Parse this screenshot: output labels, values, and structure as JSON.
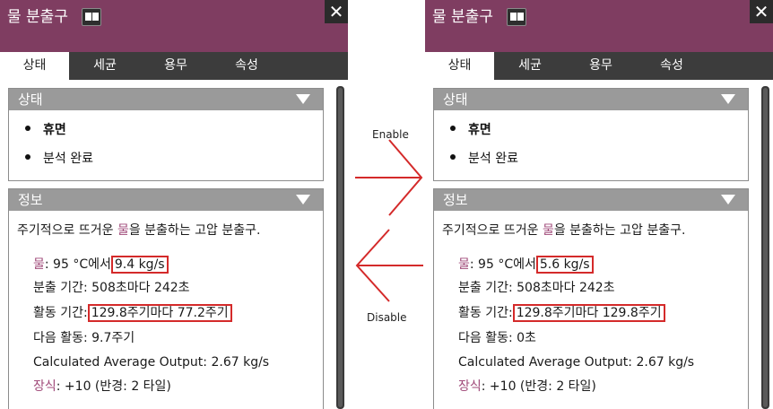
{
  "panels": {
    "before": {
      "title": "물 분출구",
      "close_label": "✕",
      "tabs": [
        "상태",
        "세균",
        "용무",
        "속성"
      ],
      "status_header": "상태",
      "status_items": [
        "휴면",
        "분석 완료"
      ],
      "info_header": "정보",
      "description_pre": "주기적으로 뜨거운 ",
      "description_word": "물",
      "description_post": "을 분출하는 고압 분출구.",
      "water_label": "물",
      "water_temp": ": 95 °C에서",
      "water_rate": "9.4 kg/s",
      "eruption_label": "분출 기간: 508초마다 242초",
      "active_label": "활동 기간:",
      "active_value": "129.8주기마다 77.2주기",
      "next_label": "다음 활동: 9.7주기",
      "avg_output": "Calculated Average Output: 2.67 kg/s",
      "decor_label": "장식",
      "decor_value": ": +10 (반경: 2 타일)"
    },
    "after": {
      "title": "물 분출구",
      "close_label": "✕",
      "tabs": [
        "상태",
        "세균",
        "용무",
        "속성"
      ],
      "status_header": "상태",
      "status_items": [
        "휴면",
        "분석 완료"
      ],
      "info_header": "정보",
      "description_pre": "주기적으로 뜨거운 ",
      "description_word": "물",
      "description_post": "을 분출하는 고압 분출구.",
      "water_label": "물",
      "water_temp": ": 95 °C에서",
      "water_rate": "5.6 kg/s",
      "eruption_label": "분출 기간: 508초마다 242초",
      "active_label": "활동 기간:",
      "active_value": "129.8주기마다 129.8주기",
      "next_label": "다음 활동: 0초",
      "avg_output": "Calculated Average Output: 2.67 kg/s",
      "decor_label": "장식",
      "decor_value": ": +10 (반경: 2 타일)"
    }
  },
  "arrows": {
    "enable_label": "Enable",
    "disable_label": "Disable",
    "color": "#d42a2a"
  },
  "colors": {
    "titlebar": "#7f3d61",
    "highlight_box": "#d42a2a",
    "pink_text": "#a04a79"
  }
}
